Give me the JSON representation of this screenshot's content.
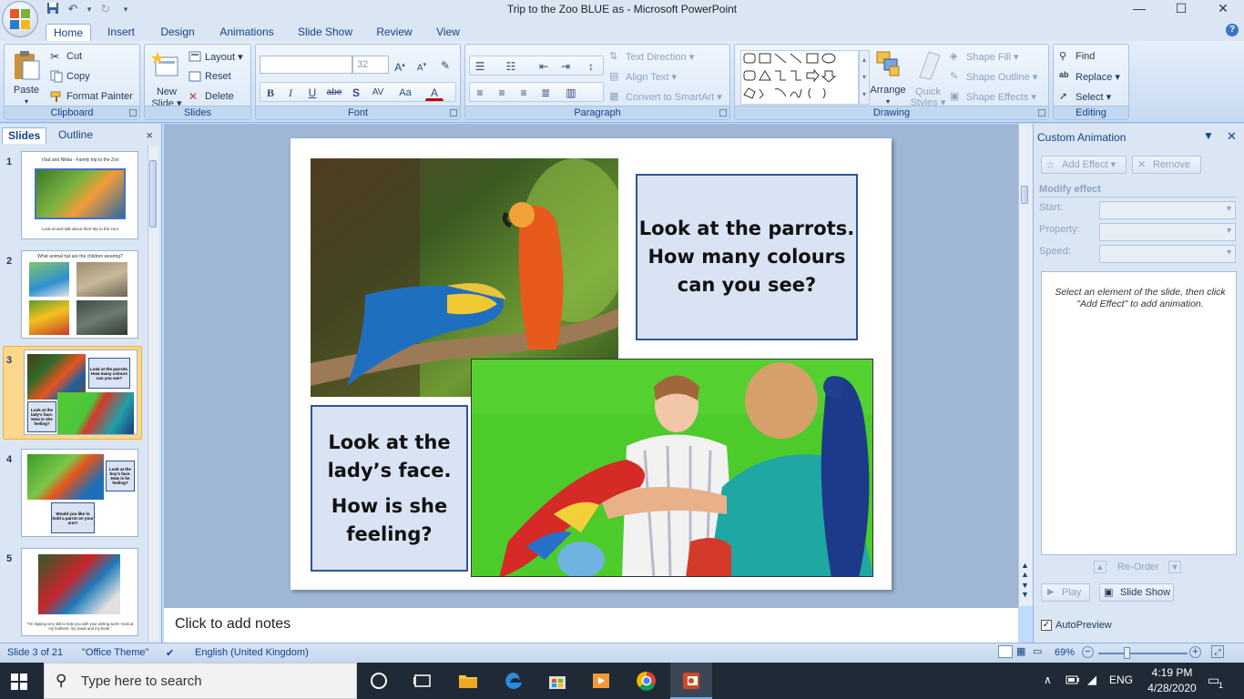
{
  "window": {
    "title": "Trip to the Zoo BLUE as  -  Microsoft PowerPoint",
    "minimize": "—",
    "maximize": "☐",
    "close": "✕"
  },
  "ribbon_tabs": [
    "Home",
    "Insert",
    "Design",
    "Animations",
    "Slide Show",
    "Review",
    "View"
  ],
  "active_tab": "Home",
  "groups": {
    "clipboard": {
      "label": "Clipboard",
      "paste": "Paste",
      "cut": "Cut",
      "copy": "Copy",
      "format_painter": "Format Painter"
    },
    "slides": {
      "label": "Slides",
      "new_slide_1": "New",
      "new_slide_2": "Slide ▾",
      "layout": "Layout ▾",
      "reset": "Reset",
      "delete": "Delete"
    },
    "font": {
      "label": "Font",
      "font_name": "",
      "font_size": "32"
    },
    "paragraph": {
      "label": "Paragraph",
      "text_direction": "Text Direction ▾",
      "align_text": "Align Text ▾",
      "convert_smartart": "Convert to SmartArt ▾"
    },
    "drawing": {
      "label": "Drawing",
      "arrange": "Arrange",
      "quick_styles_1": "Quick",
      "quick_styles_2": "Styles ▾",
      "shape_fill": "Shape Fill ▾",
      "shape_outline": "Shape Outline ▾",
      "shape_effects": "Shape Effects ▾"
    },
    "editing": {
      "label": "Editing",
      "find": "Find",
      "replace": "Replace ▾",
      "select": "Select ▾"
    }
  },
  "slides_panel": {
    "tab_slides": "Slides",
    "tab_outline": "Outline",
    "close": "×",
    "thumbnails": [
      {
        "num": "1",
        "title": "Vlad and Nikita - Family trip to the Zoo",
        "caption": "Look at and talk about their trip to the zoo!"
      },
      {
        "num": "2",
        "title": "What animal hat are the children wearing?"
      },
      {
        "num": "3",
        "box1": "Look at the parrots. How many colours can you see?",
        "box2": "Look at the lady's face. How is she feeling?"
      },
      {
        "num": "4",
        "box1": "Look at the boy's face. How is he feeling?",
        "box2": "Would you like to hold a parrot on your arm?"
      },
      {
        "num": "5",
        "caption": "\"I'm staying very still to help you with your writing work—look at my feathers, my claws and my beak.\""
      }
    ],
    "selected": "3"
  },
  "slide": {
    "box1_lines": [
      "Look at the parrots.",
      "How many colours",
      "can you see?"
    ],
    "box2_lines": [
      "Look at the",
      "lady’s face.",
      "",
      "How is she",
      "feeling?"
    ]
  },
  "notes_placeholder": "Click to add notes",
  "animation_pane": {
    "title": "Custom Animation",
    "add_effect": "Add Effect ▾",
    "remove": "Remove",
    "modify_effect": "Modify effect",
    "start_label": "Start:",
    "property_label": "Property:",
    "speed_label": "Speed:",
    "hint": "Select an element of the slide, then click \"Add Effect\" to add animation.",
    "reorder": "Re-Order",
    "play": "Play",
    "slide_show": "Slide Show",
    "autopreview": "AutoPreview"
  },
  "status": {
    "slide_info": "Slide 3 of 21",
    "theme": "\"Office Theme\"",
    "language": "English (United Kingdom)",
    "zoom": "69%"
  },
  "taskbar": {
    "search_placeholder": "Type here to search",
    "language": "ENG",
    "time": "4:19 PM",
    "date": "4/28/2020",
    "notifications": "1"
  },
  "colors": {
    "ribbon_bg": "#dbe6f4",
    "textbox_fill": "#dae3f3",
    "textbox_border": "#2f5597",
    "canvas_bg": "#9fb6d4",
    "taskbar_bg": "#1f2a36",
    "selected_thumb": "#fbd88b"
  }
}
